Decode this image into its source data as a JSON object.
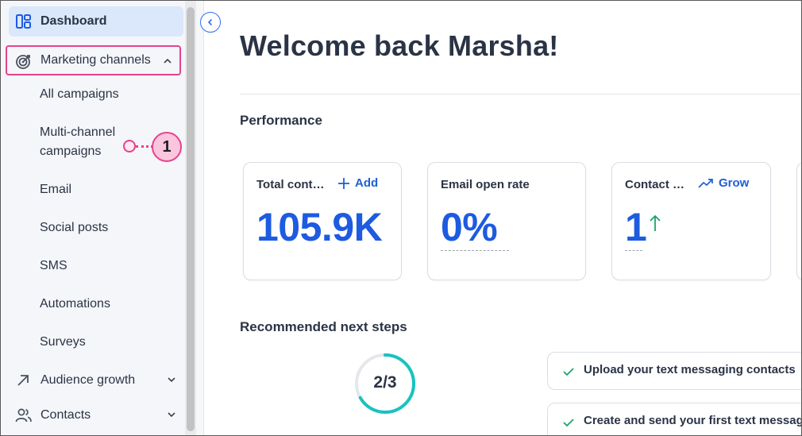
{
  "sidebar": {
    "dashboard": {
      "label": "Dashboard",
      "icon": "dashboard-icon"
    },
    "marketing": {
      "label": "Marketing channels",
      "icon": "target-icon",
      "expanded": true
    },
    "sub_items": [
      "All campaigns",
      "Multi-channel campaigns",
      "Email",
      "Social posts",
      "SMS",
      "Automations",
      "Surveys"
    ],
    "multi_channel_line1": "Multi-channel",
    "multi_channel_line2": "campaigns",
    "audience": {
      "label": "Audience growth",
      "icon": "arrow-up-right-icon"
    },
    "contacts": {
      "label": "Contacts",
      "icon": "people-icon"
    }
  },
  "callout": {
    "number": "1"
  },
  "main": {
    "title": "Welcome back Marsha!",
    "performance_heading": "Performance",
    "cards": [
      {
        "label": "Total cont…",
        "action": "Add",
        "value": "105.9K"
      },
      {
        "label": "Email open rate",
        "value": "0%"
      },
      {
        "label": "Contact …",
        "action": "Grow",
        "value": "1"
      }
    ],
    "recommended_heading": "Recommended next steps",
    "progress": {
      "text": "2/3",
      "completed": 2,
      "total": 3
    },
    "steps": [
      "Upload your text messaging contacts",
      "Create and send your first text message"
    ]
  },
  "colors": {
    "accent_blue": "#1d5be0",
    "callout_pink": "#e6428d",
    "progress_teal": "#19c2c2",
    "check_green": "#1aa56a"
  }
}
